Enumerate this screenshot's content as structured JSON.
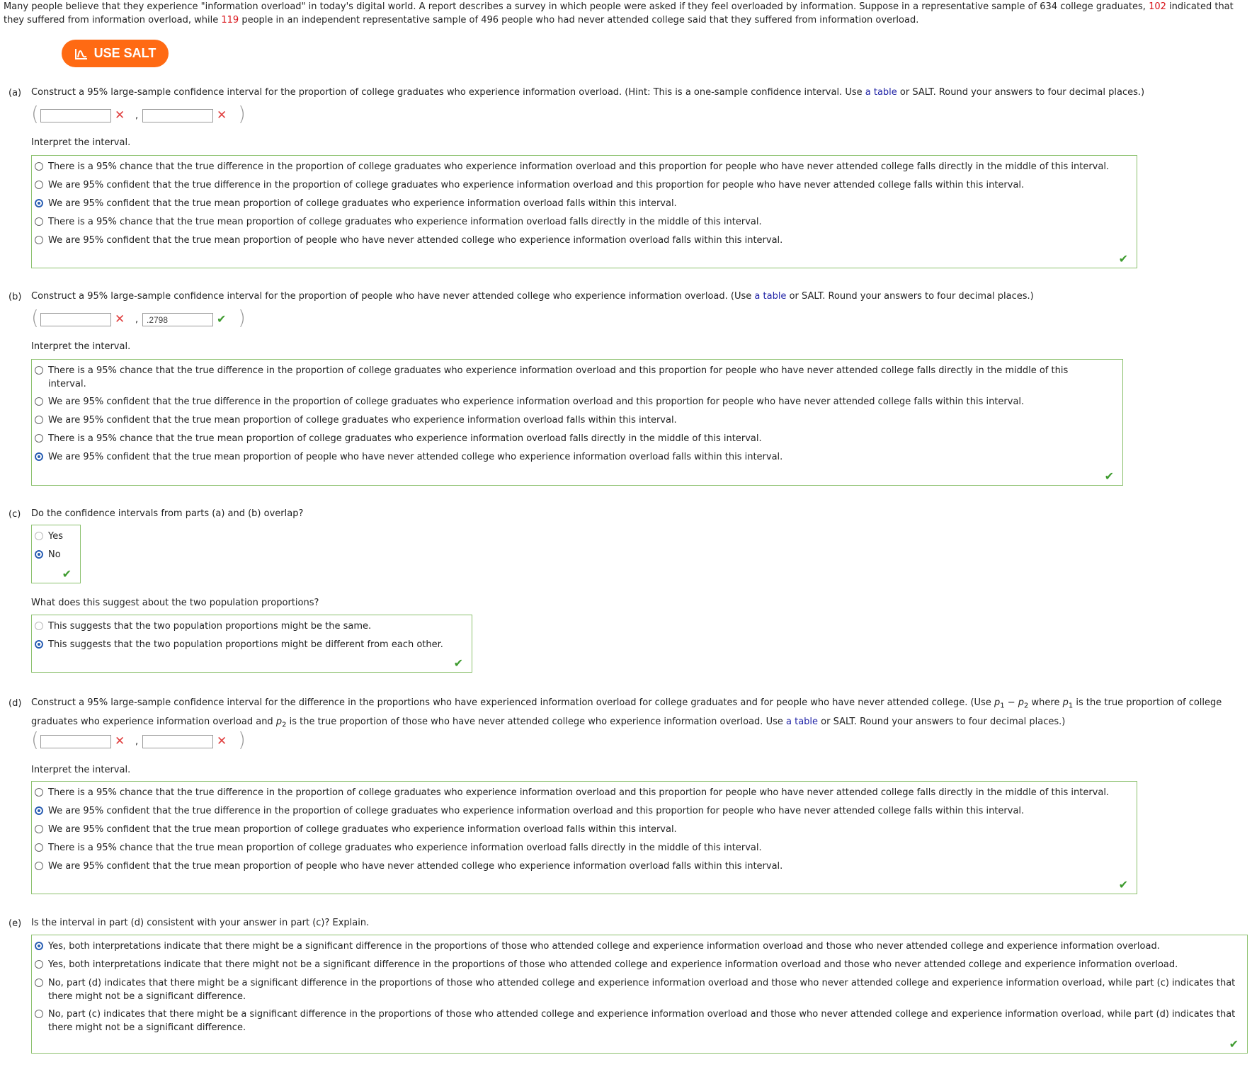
{
  "intro": {
    "part1": "Many people believe that they experience \"information overload\" in today's digital world. A report describes a survey in which people were asked if they feel overloaded by information. Suppose in a representative sample of 634 college graduates, ",
    "num1": "102",
    "part2": " indicated that they suffered from information overload, while ",
    "num2": "119",
    "part3": " people in an independent representative sample of 496 people who had never attended college said that they suffered from information overload."
  },
  "salt_button": "USE SALT",
  "link_text": "a table",
  "interpret_label": "Interpret the interval.",
  "interp_options": [
    "There is a 95% chance that the true difference in the proportion of college graduates who experience information overload and this proportion for people who have never attended college falls directly in the middle of this interval.",
    "We are 95% confident that the true difference in the proportion of college graduates who experience information overload and this proportion for people who have never attended college falls within this interval.",
    "We are 95% confident that the true mean proportion of college graduates who experience information overload falls within this interval.",
    "There is a 95% chance that the true mean proportion of college graduates who experience information overload falls directly in the middle of this interval.",
    "We are 95% confident that the true mean proportion of people who have never attended college who experience information overload falls within this interval."
  ],
  "part_a": {
    "label": "(a)",
    "text1": "Construct a 95% large-sample confidence interval for the proportion of college graduates who experience information overload. (Hint: This is a one-sample confidence interval. Use ",
    "text2": " or SALT. Round your answers to four decimal places.)",
    "lower": "",
    "upper": ""
  },
  "part_b": {
    "label": "(b)",
    "text1": "Construct a 95% large-sample confidence interval for the proportion of people who have never attended college who experience information overload. (Use ",
    "text2": " or SALT. Round your answers to four decimal places.)",
    "lower": "",
    "upper": ".2798"
  },
  "part_c": {
    "label": "(c)",
    "text": "Do the confidence intervals from parts (a) and (b) overlap?",
    "options": [
      "Yes",
      "No"
    ],
    "question2": "What does this suggest about the two population proportions?",
    "options2": [
      "This suggests that the two population proportions might be the same.",
      "This suggests that the two population proportions might be different from each other."
    ]
  },
  "part_d": {
    "label": "(d)",
    "text1": "Construct a 95% large-sample confidence interval for the difference in the proportions who have experienced information overload for college graduates and for people who have never attended college. (Use ",
    "p": "p",
    "s1": "1",
    "minus": " − ",
    "s2": "2",
    "where": " where ",
    "text2": " is the true proportion of college graduates who experience information overload and ",
    "text3": " is the true proportion of those who have never attended college who experience information overload. Use ",
    "text4": " or SALT. Round your answers to four decimal places.)",
    "lower": "",
    "upper": ""
  },
  "part_e": {
    "label": "(e)",
    "text": "Is the interval in part (d) consistent with your answer in part (c)? Explain.",
    "options": [
      "Yes, both interpretations indicate that there might be a significant difference in the proportions of those who attended college and experience information overload and those who never attended college and experience information overload.",
      "Yes, both interpretations indicate that there might not be a significant difference in the proportions of those who attended college and experience information overload and those who never attended college and experience information overload.",
      "No, part (d) indicates that there might be a significant difference in the proportions of those who attended college and experience information overload and those who never attended college and experience information overload, while part (c) indicates that there might not be a significant difference.",
      "No, part (c) indicates that there might be a significant difference in the proportions of those who attended college and experience information overload and those who never attended college and experience information overload, while part (d) indicates that there might not be a significant difference."
    ]
  },
  "icons": {
    "wrong": "red-x-icon",
    "correct": "green-check-icon",
    "salt": "salt-chart-icon"
  },
  "colors": {
    "accent": "#ff6a13",
    "correct": "#3e9b2f",
    "wrong": "#e04040",
    "link": "#2023a6",
    "highlight": "#d9151b"
  }
}
